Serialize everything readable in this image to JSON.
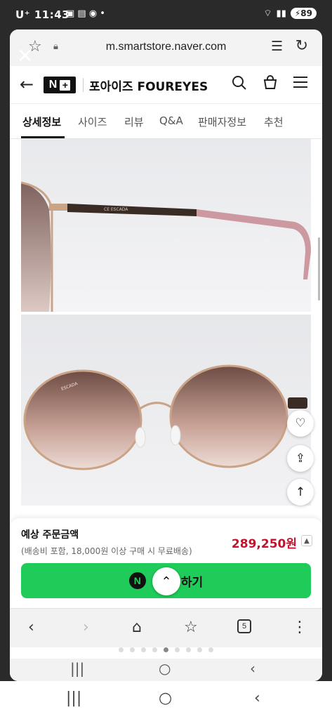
{
  "status_bar": {
    "carrier": "U⁺",
    "time": "11:43",
    "notification_icons": "▣ ▤ ◉ •",
    "battery": "89"
  },
  "browser": {
    "url": "m.smartstore.naver.com",
    "tab_count": "5"
  },
  "header": {
    "logo_text": "N",
    "logo_plus": "+",
    "store_name": "포아이즈 FOUREYES"
  },
  "tabs": [
    {
      "label": "상세정보",
      "active": true
    },
    {
      "label": "사이즈",
      "active": false
    },
    {
      "label": "리뷰",
      "active": false
    },
    {
      "label": "Q&A",
      "active": false
    },
    {
      "label": "판매자정보",
      "active": false
    },
    {
      "label": "추천",
      "active": false
    }
  ],
  "product_photo": {
    "temple_text": "CE  ESCADA",
    "lens_text": "ESCADA"
  },
  "order": {
    "label": "예상 주문금액",
    "subtext": "(배송비 포함, 18,000원 이상 구매 시 무료배송)",
    "price": "289,250원",
    "buy_button_badge": "N",
    "buy_button_label": "하기"
  },
  "icons": {
    "star": "☆",
    "lock": "🔒",
    "reader": "☰",
    "reload": "↻",
    "back": "←",
    "search": "⚲",
    "bag": "👜",
    "menu": "≡",
    "close": "✕",
    "wishlist": "♡",
    "share": "⇪",
    "up": "↑",
    "collapse": "⌃",
    "nav_back": "‹",
    "nav_forward": "›",
    "home": "⌂",
    "bookmarks": "☆",
    "more": "⋮",
    "recent": "|||",
    "sys_home": "○",
    "sys_back": "‹"
  },
  "colors": {
    "buy_green": "#1fcc5a",
    "price_red": "#c8102e"
  }
}
